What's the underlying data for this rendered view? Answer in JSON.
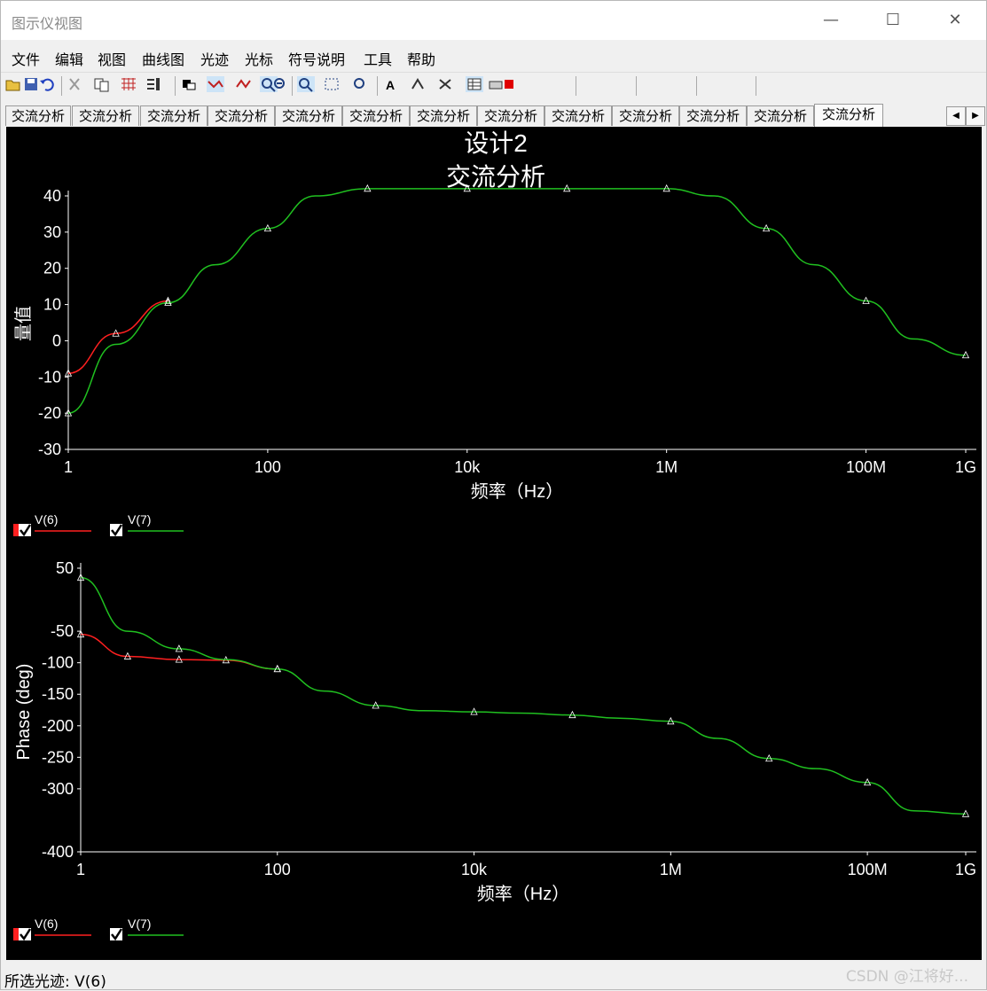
{
  "window": {
    "title": "图示仪视图",
    "minimize_glyph": "—",
    "maximize_glyph": "☐",
    "close_glyph": "✕"
  },
  "menu": [
    "文件",
    "编辑",
    "视图",
    "曲线图",
    "光迹",
    "光标",
    "符号说明",
    "工具",
    "帮助"
  ],
  "toolbar_icons": [
    "open-icon",
    "save-icon",
    "undo-icon",
    "delete-icon",
    "copy-icon",
    "paste-icon",
    "grid-icon",
    "legend-icon",
    "cursor-icon",
    "select-icon",
    "trace-icon",
    "marker-icon",
    "zoom-in-icon",
    "zoom-out-icon",
    "zoom-fit-icon",
    "zoom-select-icon",
    "zoom-x-icon",
    "text-icon",
    "font-icon",
    "props-icon",
    "export-icon",
    "print-icon",
    "overlay-icon",
    "stop-icon"
  ],
  "tabs": [
    "交流分析",
    "交流分析",
    "交流分析",
    "交流分析",
    "交流分析",
    "交流分析",
    "交流分析",
    "交流分析",
    "交流分析",
    "交流分析",
    "交流分析",
    "交流分析",
    "交流分析"
  ],
  "active_tab_index": 12,
  "graph": {
    "title_line1": "设计2",
    "title_line2": "交流分析"
  },
  "legend_top": [
    {
      "label": "V(6)",
      "color": "#ff2020"
    },
    {
      "label": "V(7)",
      "color": "#20c020"
    }
  ],
  "legend_bottom": [
    {
      "label": "V(6)",
      "color": "#ff2020"
    },
    {
      "label": "V(7)",
      "color": "#20c020"
    }
  ],
  "status": {
    "label": "所选光迹:",
    "value": "V(6)"
  },
  "watermark": "CSDN @江将好...",
  "chart_data": [
    {
      "type": "line",
      "title": "设计2 交流分析",
      "xlabel": "频率（Hz）",
      "ylabel": "量值",
      "x_scale": "log",
      "x_ticks": [
        "1",
        "100",
        "10k",
        "1M",
        "100M",
        "1G"
      ],
      "y_ticks": [
        "40",
        "30",
        "20",
        "10",
        "0",
        "-10",
        "-20",
        "-30"
      ],
      "ylim": [
        -30,
        40
      ],
      "x": [
        1,
        3,
        10,
        30,
        100,
        300,
        1000,
        3000,
        10000,
        30000,
        100000,
        300000,
        1000000,
        3000000,
        10000000,
        30000000,
        100000000,
        300000000,
        1000000000
      ],
      "series": [
        {
          "name": "V(6)",
          "color": "#ff2020",
          "values": [
            -9,
            2,
            11,
            null,
            null,
            null,
            null,
            null,
            null,
            null,
            null,
            null,
            null,
            null,
            null,
            null,
            null,
            null,
            null
          ]
        },
        {
          "name": "V(7)",
          "color": "#20c020",
          "values": [
            -20,
            -1,
            10.5,
            21,
            31,
            40,
            42,
            42,
            42,
            42,
            42,
            42,
            42,
            40,
            31,
            21,
            11,
            0.5,
            -4
          ]
        }
      ]
    },
    {
      "type": "line",
      "xlabel": "频率（Hz）",
      "ylabel": "Phase (deg)",
      "x_scale": "log",
      "x_ticks": [
        "1",
        "100",
        "10k",
        "1M",
        "100M",
        "1G"
      ],
      "y_ticks": [
        "50",
        "-50",
        "-100",
        "-150",
        "-200",
        "-250",
        "-300",
        "-400"
      ],
      "ylim": [
        -400,
        50
      ],
      "x": [
        1,
        3,
        10,
        30,
        100,
        300,
        1000,
        3000,
        10000,
        30000,
        100000,
        300000,
        1000000,
        3000000,
        10000000,
        30000000,
        100000000,
        300000000,
        1000000000
      ],
      "series": [
        {
          "name": "V(6)",
          "color": "#ff2020",
          "values": [
            -55,
            -90,
            -95,
            -96,
            -110,
            null,
            null,
            null,
            null,
            null,
            null,
            null,
            null,
            null,
            null,
            null,
            null,
            null,
            null
          ]
        },
        {
          "name": "V(7)",
          "color": "#20c020",
          "values": [
            35,
            -50,
            -78,
            -95,
            -110,
            -145,
            -168,
            -176,
            -178,
            -180,
            -183,
            -188,
            -193,
            -220,
            -252,
            -268,
            -290,
            -335,
            -340
          ]
        }
      ]
    }
  ]
}
